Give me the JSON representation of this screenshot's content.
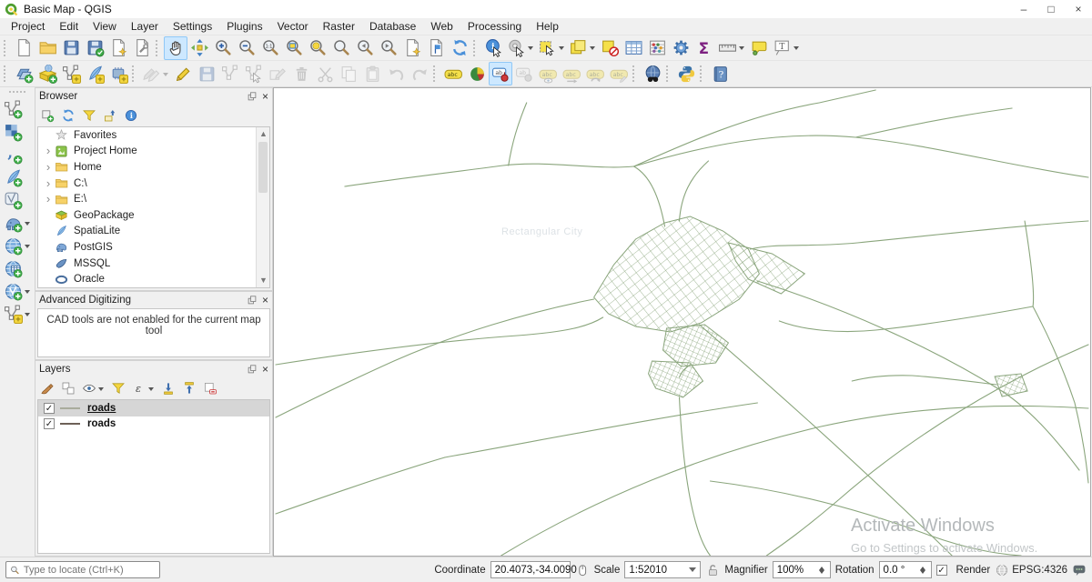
{
  "window": {
    "title": "Basic Map - QGIS",
    "minimize": "–",
    "maximize": "□",
    "close": "×"
  },
  "menu": [
    "Project",
    "Edit",
    "View",
    "Layer",
    "Settings",
    "Plugins",
    "Vector",
    "Raster",
    "Database",
    "Web",
    "Processing",
    "Help"
  ],
  "toolbar_row1": [
    {
      "name": "project-toolbar",
      "buttons": [
        {
          "icon": "new-project"
        },
        {
          "icon": "open-project"
        },
        {
          "icon": "save-project"
        },
        {
          "icon": "save-project-as"
        },
        {
          "icon": "new-print-layout"
        },
        {
          "icon": "show-layout-manager"
        }
      ]
    },
    {
      "name": "map-navigation-toolbar",
      "buttons": [
        {
          "icon": "pan-map",
          "active": true
        },
        {
          "icon": "pan-to-selection"
        },
        {
          "icon": "zoom-in"
        },
        {
          "icon": "zoom-out"
        },
        {
          "icon": "zoom-native"
        },
        {
          "icon": "zoom-full"
        },
        {
          "icon": "zoom-to-selection"
        },
        {
          "icon": "zoom-to-layer"
        },
        {
          "icon": "zoom-last"
        },
        {
          "icon": "zoom-next"
        },
        {
          "icon": "new-bookmark"
        },
        {
          "icon": "show-bookmarks"
        },
        {
          "icon": "refresh"
        }
      ]
    },
    {
      "name": "attributes-toolbar",
      "buttons": [
        {
          "icon": "identify-features"
        },
        {
          "icon": "run-feature-action",
          "dd": true
        },
        {
          "icon": "select-features",
          "dd": true
        },
        {
          "icon": "select-by-expression",
          "dd": true
        },
        {
          "icon": "deselect-features"
        },
        {
          "icon": "open-attribute-table"
        },
        {
          "icon": "field-calculator"
        },
        {
          "icon": "processing-toolbox"
        },
        {
          "icon": "statistical-summary"
        },
        {
          "icon": "measure-line",
          "dd": true
        },
        {
          "icon": "map-tips"
        },
        {
          "icon": "text-annotation",
          "dd": true
        }
      ]
    }
  ],
  "toolbar_row2": [
    {
      "name": "data-source-manager-toolbar",
      "buttons": [
        {
          "icon": "open-data-source-manager"
        },
        {
          "icon": "new-geopackage-layer"
        },
        {
          "icon": "new-shapefile-layer"
        },
        {
          "icon": "new-spatialite-layer"
        },
        {
          "icon": "new-temporary-scratch-layer"
        }
      ]
    },
    {
      "name": "digitizing-toolbar",
      "buttons": [
        {
          "icon": "current-edits",
          "dd": true,
          "disabled": true
        },
        {
          "icon": "toggle-editing"
        },
        {
          "icon": "save-layer-edits",
          "disabled": true
        },
        {
          "icon": "digitize-segment",
          "disabled": true
        },
        {
          "icon": "vertex-tool",
          "disabled": true
        },
        {
          "icon": "modify-attributes",
          "disabled": true
        },
        {
          "icon": "delete-selected",
          "disabled": true
        },
        {
          "icon": "cut-features",
          "disabled": true
        },
        {
          "icon": "copy-features",
          "disabled": true
        },
        {
          "icon": "paste-features",
          "disabled": true
        },
        {
          "icon": "undo",
          "disabled": true
        },
        {
          "icon": "redo",
          "disabled": true
        }
      ]
    },
    {
      "name": "label-toolbar",
      "buttons": [
        {
          "icon": "layer-labeling"
        },
        {
          "icon": "layer-diagram"
        },
        {
          "icon": "change-label",
          "active": true
        },
        {
          "icon": "pin-labels",
          "disabled": true
        },
        {
          "icon": "show-hidden-labels",
          "disabled": true
        },
        {
          "icon": "move-label",
          "disabled": true
        },
        {
          "icon": "rotate-label",
          "disabled": true
        },
        {
          "icon": "change-label-properties",
          "disabled": true
        }
      ]
    },
    {
      "name": "web-toolbar",
      "buttons": [
        {
          "icon": "metasearch"
        }
      ]
    },
    {
      "name": "plugins-toolbar",
      "buttons": [
        {
          "icon": "python-console"
        }
      ]
    },
    {
      "name": "help-toolbar",
      "buttons": [
        {
          "icon": "help-contents"
        }
      ]
    }
  ],
  "manage_layers_toolbar": [
    {
      "icon": "add-vector-layer"
    },
    {
      "icon": "add-raster-layer"
    },
    {
      "icon": "add-delimited-text-layer"
    },
    {
      "icon": "add-spatialite-layer"
    },
    {
      "icon": "add-mesh-layer"
    },
    {
      "icon": "add-postgis-layers",
      "dd": true
    },
    {
      "icon": "add-wms-layer",
      "dd": true
    },
    {
      "icon": "add-wcs-layer"
    },
    {
      "icon": "add-wfs-layer",
      "dd": true
    },
    {
      "icon": "new-virtual-layer",
      "dd": true
    }
  ],
  "browser": {
    "title": "Browser",
    "tools": [
      {
        "icon": "add-selected-layers"
      },
      {
        "icon": "refresh-browser"
      },
      {
        "icon": "filter-browser"
      },
      {
        "icon": "collapse-all"
      },
      {
        "icon": "enable-properties"
      }
    ],
    "items": [
      {
        "label": "Favorites",
        "icon": "favorites",
        "expandable": false
      },
      {
        "label": "Project Home",
        "icon": "project-home",
        "expandable": true
      },
      {
        "label": "Home",
        "icon": "folder-item",
        "expandable": true
      },
      {
        "label": "C:\\",
        "icon": "folder-item",
        "expandable": true
      },
      {
        "label": "E:\\",
        "icon": "folder-item",
        "expandable": true
      },
      {
        "label": "GeoPackage",
        "icon": "geopackage",
        "expandable": false
      },
      {
        "label": "SpatiaLite",
        "icon": "spatialite",
        "expandable": false
      },
      {
        "label": "PostGIS",
        "icon": "postgis",
        "expandable": false
      },
      {
        "label": "MSSQL",
        "icon": "mssql",
        "expandable": false
      },
      {
        "label": "Oracle",
        "icon": "oracle",
        "expandable": false
      }
    ]
  },
  "advanced_digitizing": {
    "title": "Advanced Digitizing",
    "message": "CAD tools are not enabled for the current map tool"
  },
  "layers_panel": {
    "title": "Layers",
    "tools": [
      {
        "icon": "open-layer-styling"
      },
      {
        "icon": "add-group"
      },
      {
        "icon": "manage-map-themes",
        "dd": true
      },
      {
        "icon": "filter-legend"
      },
      {
        "icon": "filter-by-expression",
        "dd": true
      },
      {
        "icon": "expand-all"
      },
      {
        "icon": "collapse-all-layers"
      },
      {
        "icon": "remove-layer"
      }
    ],
    "layers": [
      {
        "label": "roads",
        "checked": true,
        "selected": true,
        "symbol_color": "#a9ab9c"
      },
      {
        "label": "roads",
        "checked": true,
        "selected": false,
        "symbol_color": "#6d6157"
      }
    ]
  },
  "map": {
    "road_color": "#8aa57c",
    "faint_label": "Rectangular City",
    "watermark_title": "Activate Windows",
    "watermark_subtitle": "Go to Settings to activate Windows."
  },
  "statusbar": {
    "locator_placeholder": "Type to locate (Ctrl+K)",
    "coordinate_label": "Coordinate",
    "coordinate_value": "20.4073,-34.0090",
    "scale_label": "Scale",
    "scale_value": "1:52010",
    "magnifier_label": "Magnifier",
    "magnifier_value": "100%",
    "rotation_label": "Rotation",
    "rotation_value": "0.0 °",
    "render_label": "Render",
    "crs": "EPSG:4326"
  }
}
